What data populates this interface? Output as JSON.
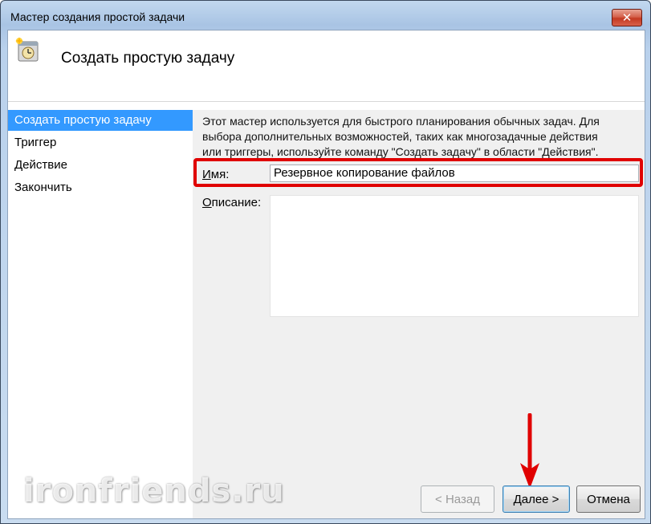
{
  "window": {
    "title": "Мастер создания простой задачи",
    "close_label": "✕"
  },
  "header": {
    "title": "Создать простую задачу",
    "icon": "task-scheduler-icon"
  },
  "nav": {
    "items": [
      {
        "label": "Создать простую задачу",
        "active": true
      },
      {
        "label": "Триггер",
        "active": false
      },
      {
        "label": "Действие",
        "active": false
      },
      {
        "label": "Закончить",
        "active": false
      }
    ]
  },
  "panel": {
    "intro_lines": [
      "Этот мастер используется для быстрого планирования обычных задач.  Для",
      "выбора дополнительных возможностей, таких как многозадачные действия",
      "или триггеры, используйте команду \"Создать задачу\" в области \"Действия\"."
    ],
    "name_label_accel": "И",
    "name_label_rest": "мя:",
    "name_value": "Резервное копирование файлов",
    "desc_label_accel": "О",
    "desc_label_rest": "писание:",
    "desc_value": ""
  },
  "buttons": {
    "back": "< Назад",
    "next": "Далее >",
    "cancel": "Отмена"
  },
  "watermark": "ironfriends.ru",
  "colors": {
    "nav_active_bg": "#3399ff",
    "highlight": "#e00000",
    "arrow": "#e00000"
  }
}
